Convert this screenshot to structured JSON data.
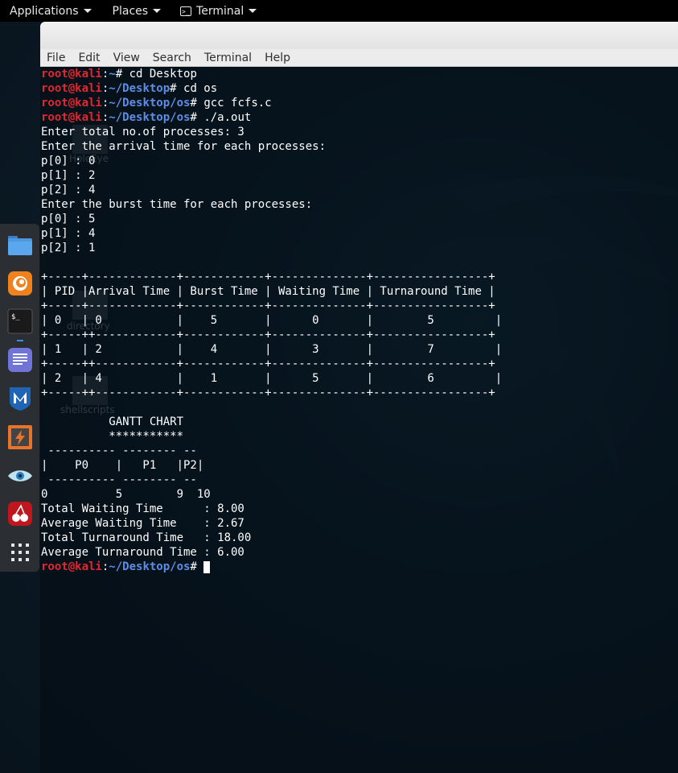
{
  "panel": {
    "applications": "Applications",
    "places": "Places",
    "terminal": "Terminal"
  },
  "dock": {
    "items": [
      {
        "icon": "files-icon"
      },
      {
        "icon": "firefox-icon"
      },
      {
        "icon": "terminal-icon"
      },
      {
        "icon": "text-editor-icon"
      },
      {
        "icon": "metasploit-icon"
      },
      {
        "icon": "burpsuite-icon"
      },
      {
        "icon": "eye-icon"
      },
      {
        "icon": "cherrytree-icon"
      },
      {
        "icon": "show-apps-icon"
      }
    ]
  },
  "desktop_labels": {
    "label1": "HoleEye",
    "label2": "directory",
    "label3": "shellscripts"
  },
  "menubar": {
    "file": "File",
    "edit": "Edit",
    "view": "View",
    "search": "Search",
    "terminal": "Terminal",
    "help": "Help"
  },
  "prompt": {
    "user": "root@kali",
    "sep": ":",
    "home": "~",
    "desktop": "~/Desktop",
    "os": "~/Desktop/os",
    "symbol": "# "
  },
  "commands": {
    "c1": "cd Desktop",
    "c2": "cd os",
    "c3": "gcc fcfs.c",
    "c4": "./a.out"
  },
  "output": [
    "Enter total no.of processes: 3",
    "Enter the arrival time for each processes:",
    "p[0] : 0",
    "p[1] : 2",
    "p[2] : 4",
    "Enter the burst time for each processes:",
    "p[0] : 5",
    "p[1] : 4",
    "p[2] : 1",
    "",
    "+-----+-------------+------------+--------------+-----------------+",
    "| PID |Arrival Time | Burst Time | Waiting Time | Turnaround Time |",
    "+-----+-------------+------------+--------------+-----------------+",
    "| 0   | 0           |    5       |      0       |        5         |",
    "+-----++------------+------------+--------------+-----------------+",
    "| 1   | 2           |    4       |      3       |        7         |",
    "+-----++------------+------------+--------------+-----------------+",
    "| 2   | 4           |    1       |      5       |        6         |",
    "+-----++------------+------------+--------------+-----------------+",
    "",
    "          GANTT CHART",
    "          ***********",
    " ---------- -------- --",
    "|    P0    |   P1   |P2|",
    " ---------- -------- --",
    "0          5        9  10",
    "Total Waiting Time      : 8.00",
    "Average Waiting Time    : 2.67",
    "Total Turnaround Time   : 18.00",
    "Average Turnaround Time : 6.00"
  ],
  "colors": {
    "prompt_user": "#e0262e",
    "prompt_path": "#5b8ee6",
    "text": "#ffffff"
  }
}
